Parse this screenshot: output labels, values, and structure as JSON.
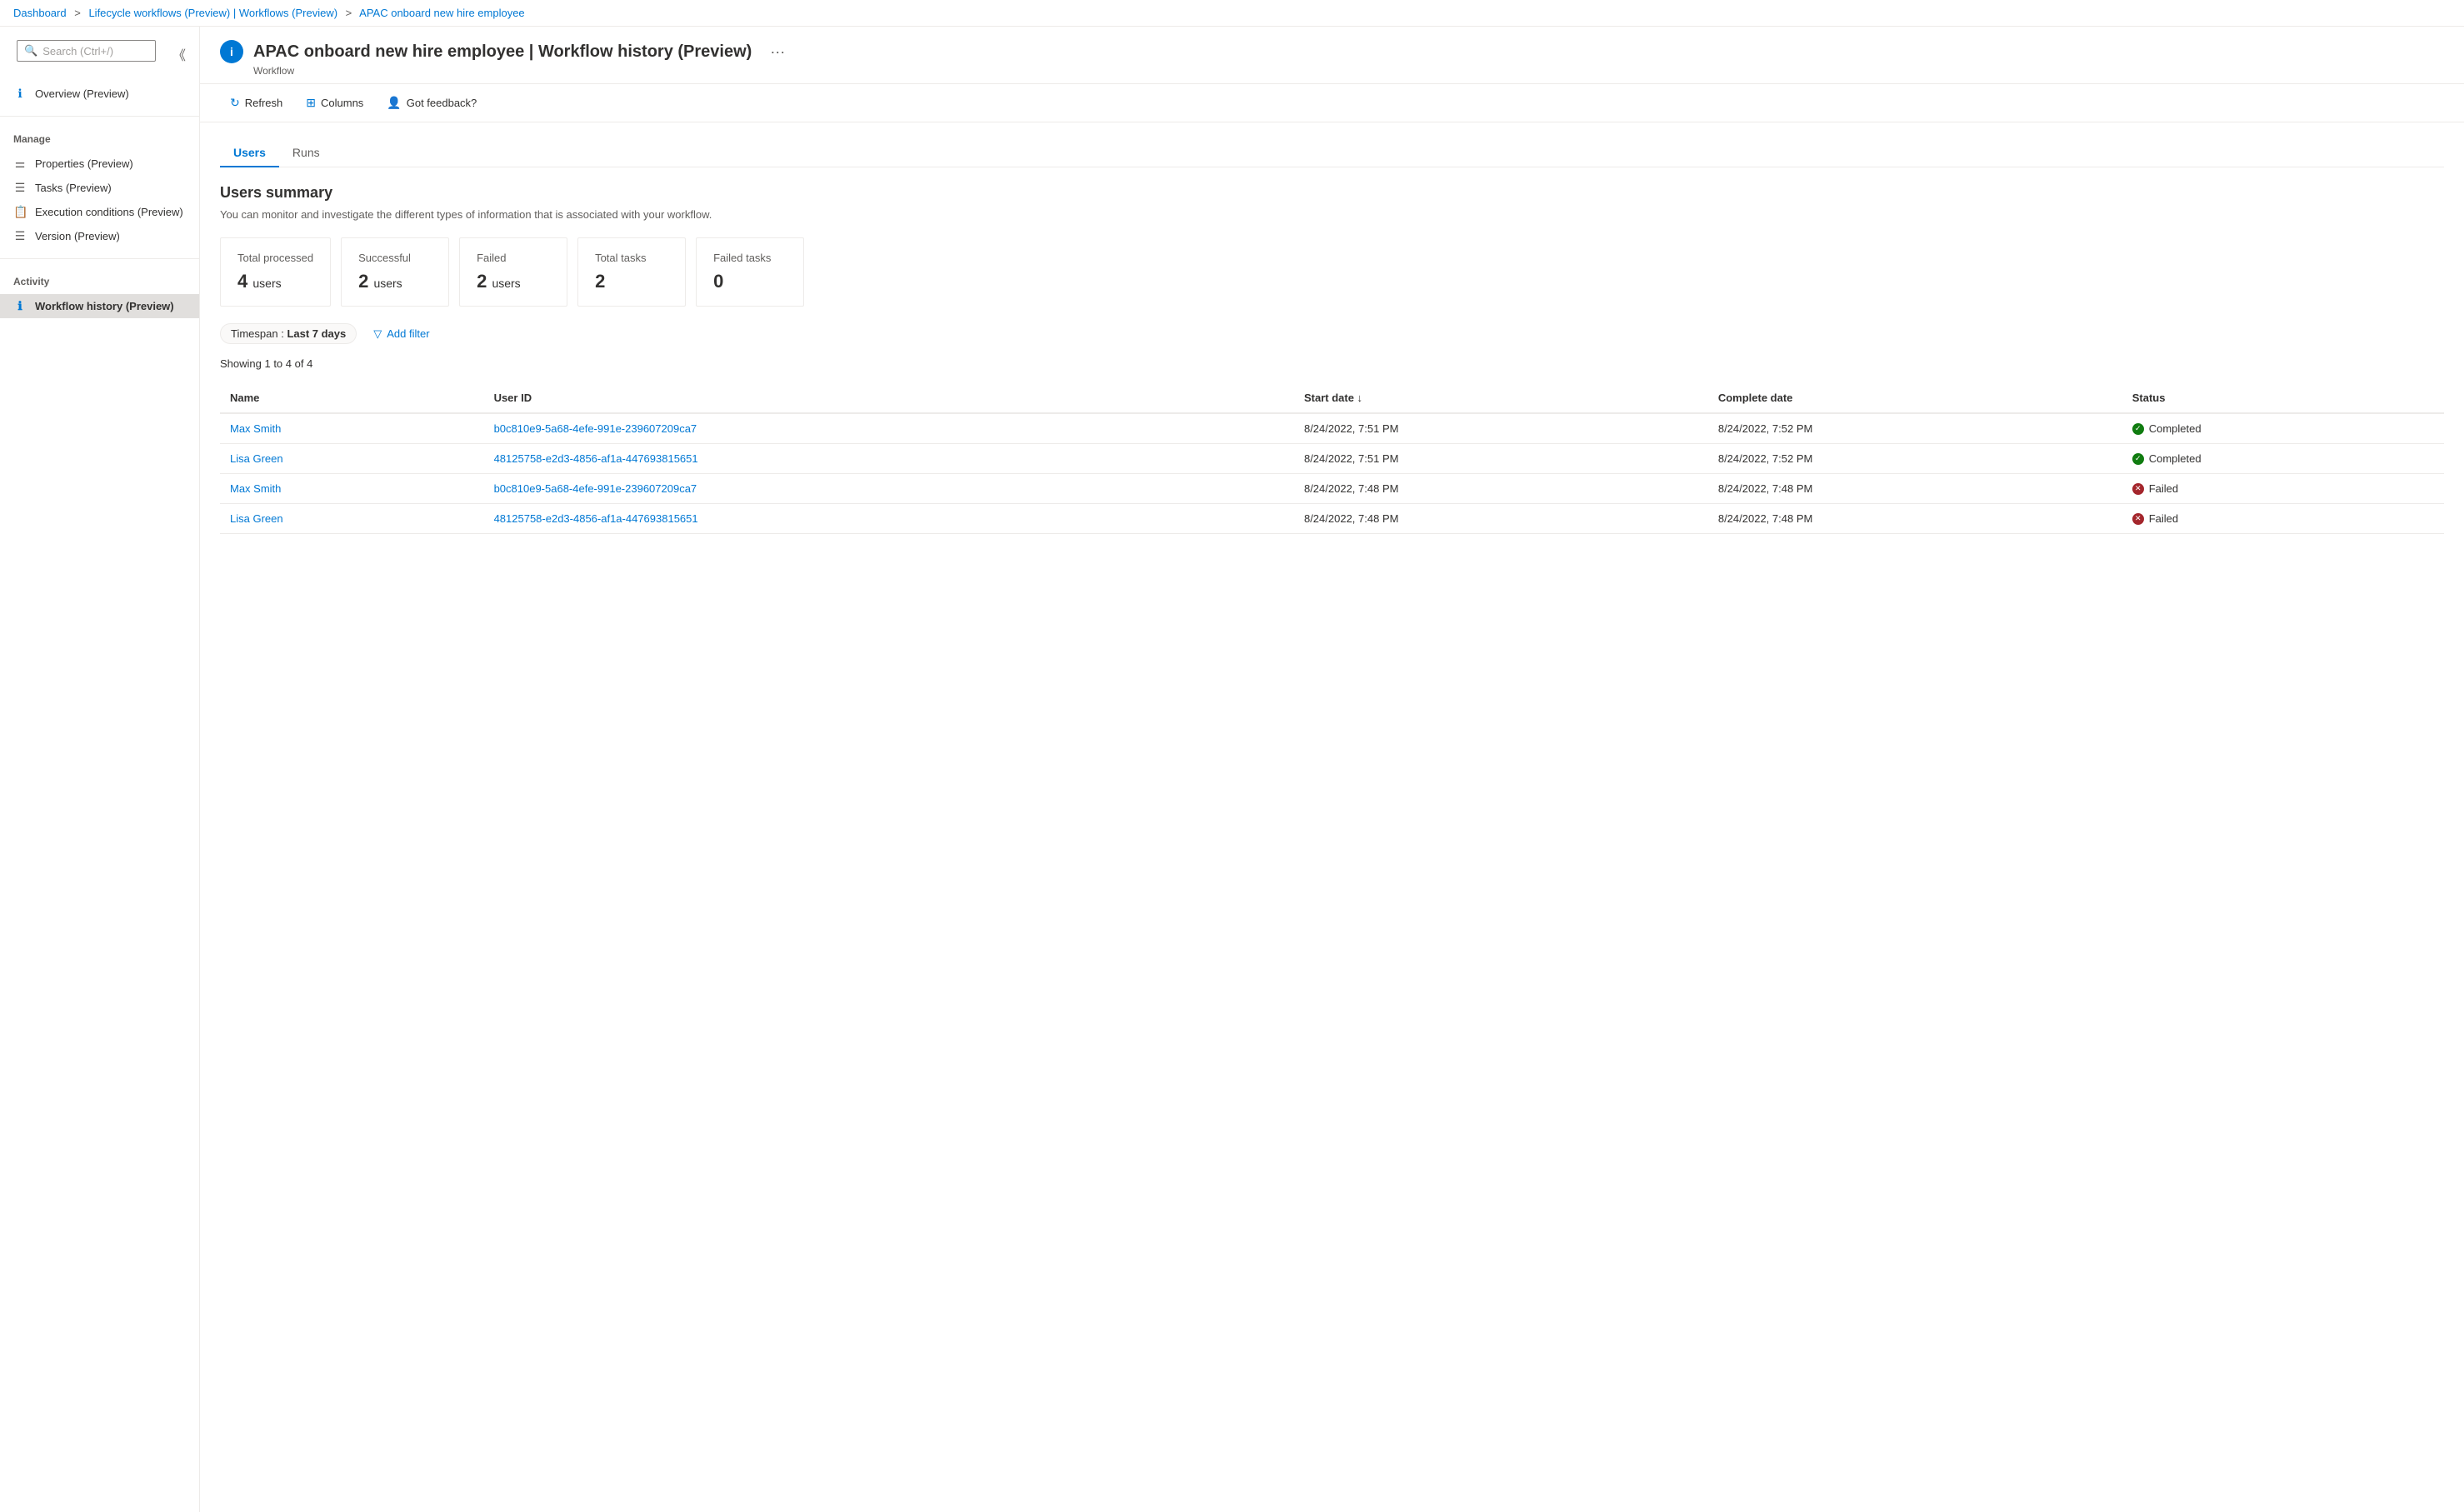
{
  "breadcrumb": {
    "items": [
      {
        "label": "Dashboard",
        "link": true
      },
      {
        "label": "Lifecycle workflows (Preview) | Workflows (Preview)",
        "link": true
      },
      {
        "label": "APAC onboard new hire employee",
        "link": true
      }
    ]
  },
  "page": {
    "icon": "i",
    "title": "APAC onboard new hire employee | Workflow history (Preview)",
    "subtitle": "Workflow",
    "more_label": "···"
  },
  "toolbar": {
    "refresh_label": "Refresh",
    "columns_label": "Columns",
    "feedback_label": "Got feedback?"
  },
  "sidebar": {
    "search_placeholder": "Search (Ctrl+/)",
    "overview_label": "Overview (Preview)",
    "manage_label": "Manage",
    "manage_items": [
      {
        "label": "Properties (Preview)",
        "icon": "≡≡"
      },
      {
        "label": "Tasks (Preview)",
        "icon": "≡"
      },
      {
        "label": "Execution conditions (Preview)",
        "icon": "📋"
      },
      {
        "label": "Version (Preview)",
        "icon": "≡"
      }
    ],
    "activity_label": "Activity",
    "activity_items": [
      {
        "label": "Workflow history (Preview)",
        "icon": "ℹ",
        "active": true
      }
    ]
  },
  "tabs": [
    {
      "label": "Users",
      "active": true
    },
    {
      "label": "Runs",
      "active": false
    }
  ],
  "users_summary": {
    "title": "Users summary",
    "description": "You can monitor and investigate the different types of information that is associated with your workflow.",
    "cards": [
      {
        "label": "Total processed",
        "value": "4",
        "unit": "users"
      },
      {
        "label": "Successful",
        "value": "2",
        "unit": "users"
      },
      {
        "label": "Failed",
        "value": "2",
        "unit": "users"
      },
      {
        "label": "Total tasks",
        "value": "2",
        "unit": ""
      },
      {
        "label": "Failed tasks",
        "value": "0",
        "unit": ""
      }
    ]
  },
  "filters": {
    "timespan_prefix": "Timespan : ",
    "timespan_value": "Last 7 days",
    "add_filter_label": "Add filter"
  },
  "showing_text": "Showing 1 to 4 of 4",
  "table": {
    "columns": [
      {
        "label": "Name"
      },
      {
        "label": "User ID"
      },
      {
        "label": "Start date ↓"
      },
      {
        "label": "Complete date"
      },
      {
        "label": "Status"
      }
    ],
    "rows": [
      {
        "name": "Max Smith",
        "user_id": "b0c810e9-5a68-4efe-991e-239607209ca7",
        "start_date": "8/24/2022, 7:51 PM",
        "complete_date": "8/24/2022, 7:52 PM",
        "status": "Completed",
        "status_type": "completed"
      },
      {
        "name": "Lisa Green",
        "user_id": "48125758-e2d3-4856-af1a-447693815651",
        "start_date": "8/24/2022, 7:51 PM",
        "complete_date": "8/24/2022, 7:52 PM",
        "status": "Completed",
        "status_type": "completed"
      },
      {
        "name": "Max Smith",
        "user_id": "b0c810e9-5a68-4efe-991e-239607209ca7",
        "start_date": "8/24/2022, 7:48 PM",
        "complete_date": "8/24/2022, 7:48 PM",
        "status": "Failed",
        "status_type": "failed"
      },
      {
        "name": "Lisa Green",
        "user_id": "48125758-e2d3-4856-af1a-447693815651",
        "start_date": "8/24/2022, 7:48 PM",
        "complete_date": "8/24/2022, 7:48 PM",
        "status": "Failed",
        "status_type": "failed"
      }
    ]
  }
}
